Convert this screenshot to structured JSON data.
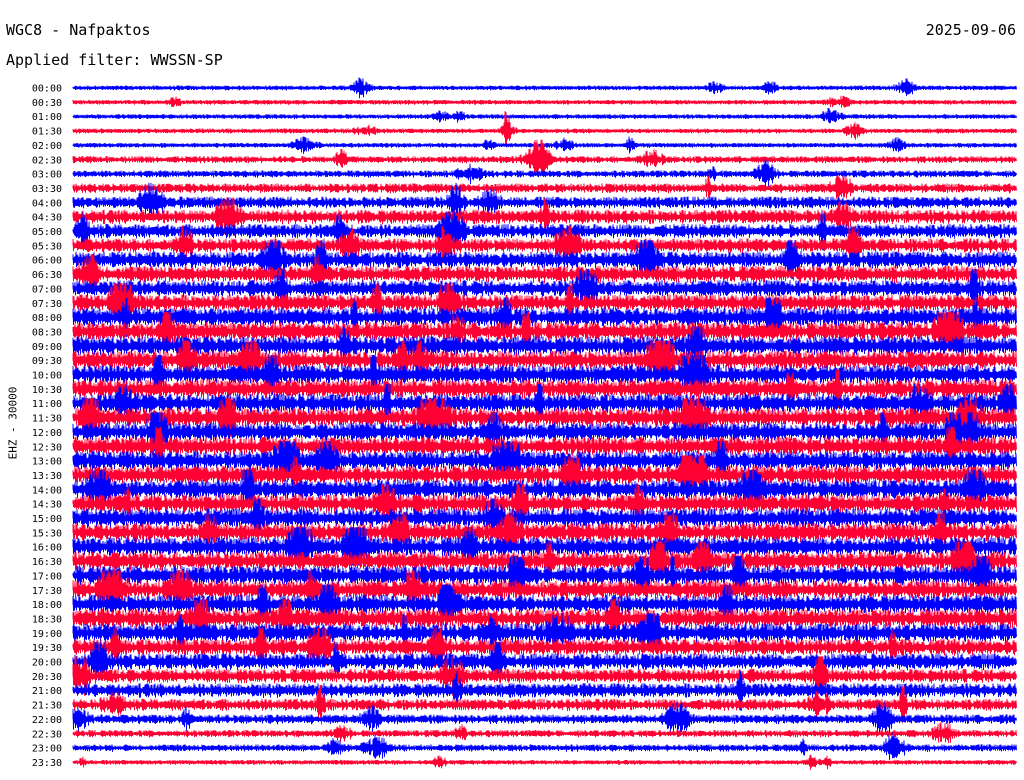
{
  "header": {
    "station": "WGC8 - Nafpaktos",
    "date": "2025-09-06",
    "filter": "Applied filter: WWSSN-SP"
  },
  "chart_data": {
    "type": "line",
    "title": "WGC8 - Nafpaktos",
    "subtitle": "Applied filter: WWSSN-SP",
    "ylabel": "EHZ - 30000",
    "series_colors": [
      "#0000ff",
      "#ff0033"
    ],
    "categories": [
      "00:00",
      "00:30",
      "01:00",
      "01:30",
      "02:00",
      "02:30",
      "03:00",
      "03:30",
      "04:00",
      "04:30",
      "05:00",
      "05:30",
      "06:00",
      "06:30",
      "07:00",
      "07:30",
      "08:00",
      "08:30",
      "09:00",
      "09:30",
      "10:00",
      "10:30",
      "11:00",
      "11:30",
      "12:00",
      "12:30",
      "13:00",
      "13:30",
      "14:00",
      "14:30",
      "15:00",
      "15:30",
      "16:00",
      "16:30",
      "17:00",
      "17:30",
      "18:00",
      "18:30",
      "19:00",
      "19:30",
      "20:00",
      "20:30",
      "21:00",
      "21:30",
      "22:00",
      "22:30",
      "23:00",
      "23:30"
    ],
    "noise_level": [
      2,
      2,
      2,
      2,
      2,
      3,
      3,
      4,
      5,
      6,
      6,
      6,
      7,
      7,
      7,
      7,
      8,
      8,
      8,
      8,
      8,
      8,
      8,
      8,
      8,
      8,
      8,
      8,
      8,
      8,
      8,
      8,
      8,
      8,
      8,
      8,
      8,
      8,
      8,
      7,
      7,
      6,
      6,
      5,
      4,
      3,
      3,
      2
    ]
  }
}
